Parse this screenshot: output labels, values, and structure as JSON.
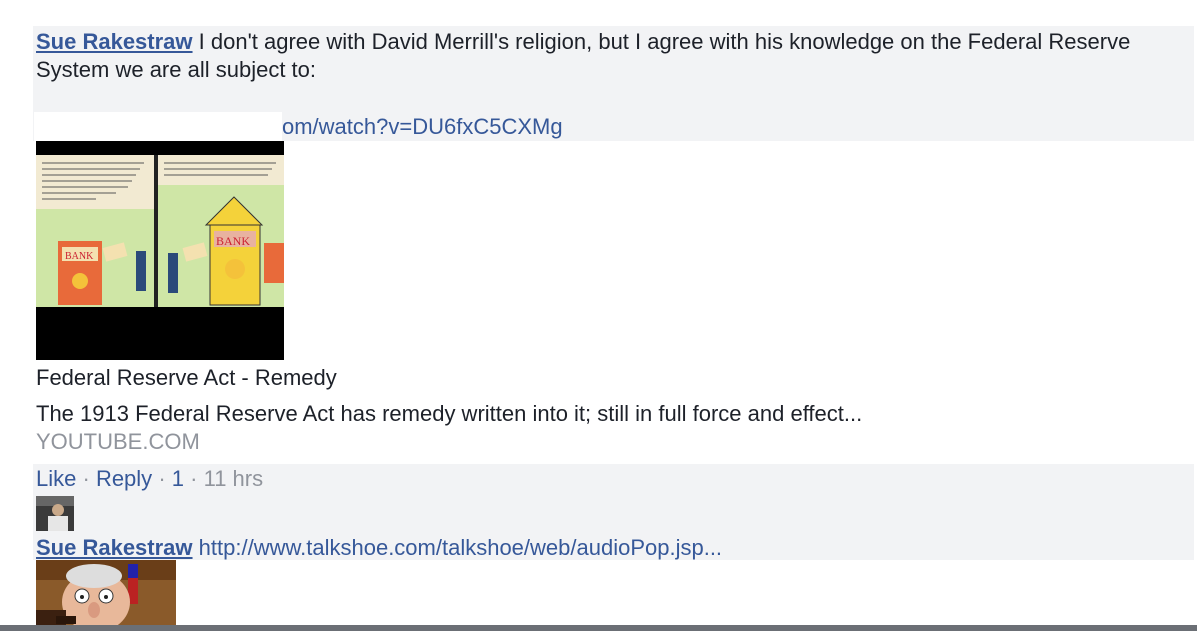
{
  "comment1": {
    "author": "Sue Rakestraw",
    "text": "I don't agree with David Merrill's religion, but I agree with his knowledge on the Federal Reserve System we are all subject to:",
    "url_visible": "om/watch?v=DU6fxC5CXMg"
  },
  "link_card": {
    "title": "Federal Reserve Act - Remedy",
    "description": "The 1913 Federal Reserve Act has remedy written into it; still in full force and effect...",
    "domain": "YOUTUBE.COM",
    "thumb_label_left": "BANK",
    "thumb_label_right": "BANK"
  },
  "actions": {
    "like": "Like",
    "reply": "Reply",
    "count": "1",
    "time": "11 hrs",
    "sep": "·"
  },
  "comment2": {
    "author": "Sue Rakestraw",
    "link": "http://www.talkshoe.com/talkshoe/web/audioPop.jsp..."
  }
}
